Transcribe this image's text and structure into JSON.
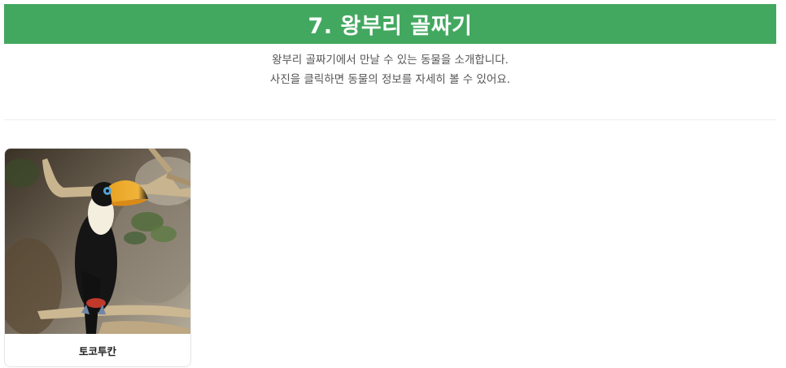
{
  "header": {
    "title": "7. 왕부리 골짜기"
  },
  "intro": {
    "line1": "왕부리 골짜기에서 만날 수 있는 동물을 소개합니다.",
    "line2": "사진을 클릭하면 동물의 정보를 자세히 볼 수 있어요."
  },
  "colors": {
    "title_bar": "#43a85f",
    "title_text": "#ffffff",
    "intro_text": "#555555"
  },
  "animals": [
    {
      "name": "토코투칸",
      "photo": "toco-toucan-on-branch"
    }
  ]
}
